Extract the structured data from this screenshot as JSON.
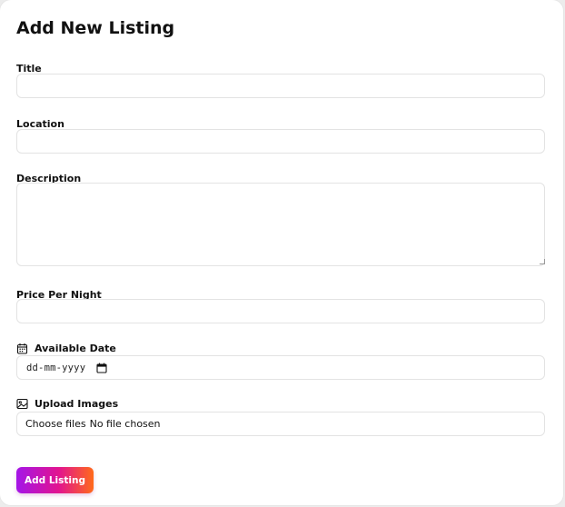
{
  "form": {
    "title": "Add New Listing",
    "fields": {
      "title": {
        "label": "Title",
        "value": "",
        "placeholder": ""
      },
      "location": {
        "label": "Location",
        "value": "",
        "placeholder": ""
      },
      "description": {
        "label": "Description",
        "value": "",
        "placeholder": ""
      },
      "price": {
        "label": "Price Per Night",
        "value": "",
        "placeholder": ""
      },
      "date": {
        "label": "Available Date",
        "display": "dd-mm-yyyy",
        "icon": "calendar-icon"
      },
      "images": {
        "label": "Upload Images",
        "button_label": "Choose files",
        "status": "No file chosen",
        "icon": "image-icon"
      }
    },
    "submit_label": "Add Listing"
  },
  "colors": {
    "accent_start": "#a415e8",
    "accent_mid": "#e2148f",
    "accent_end": "#ff6a1a"
  }
}
